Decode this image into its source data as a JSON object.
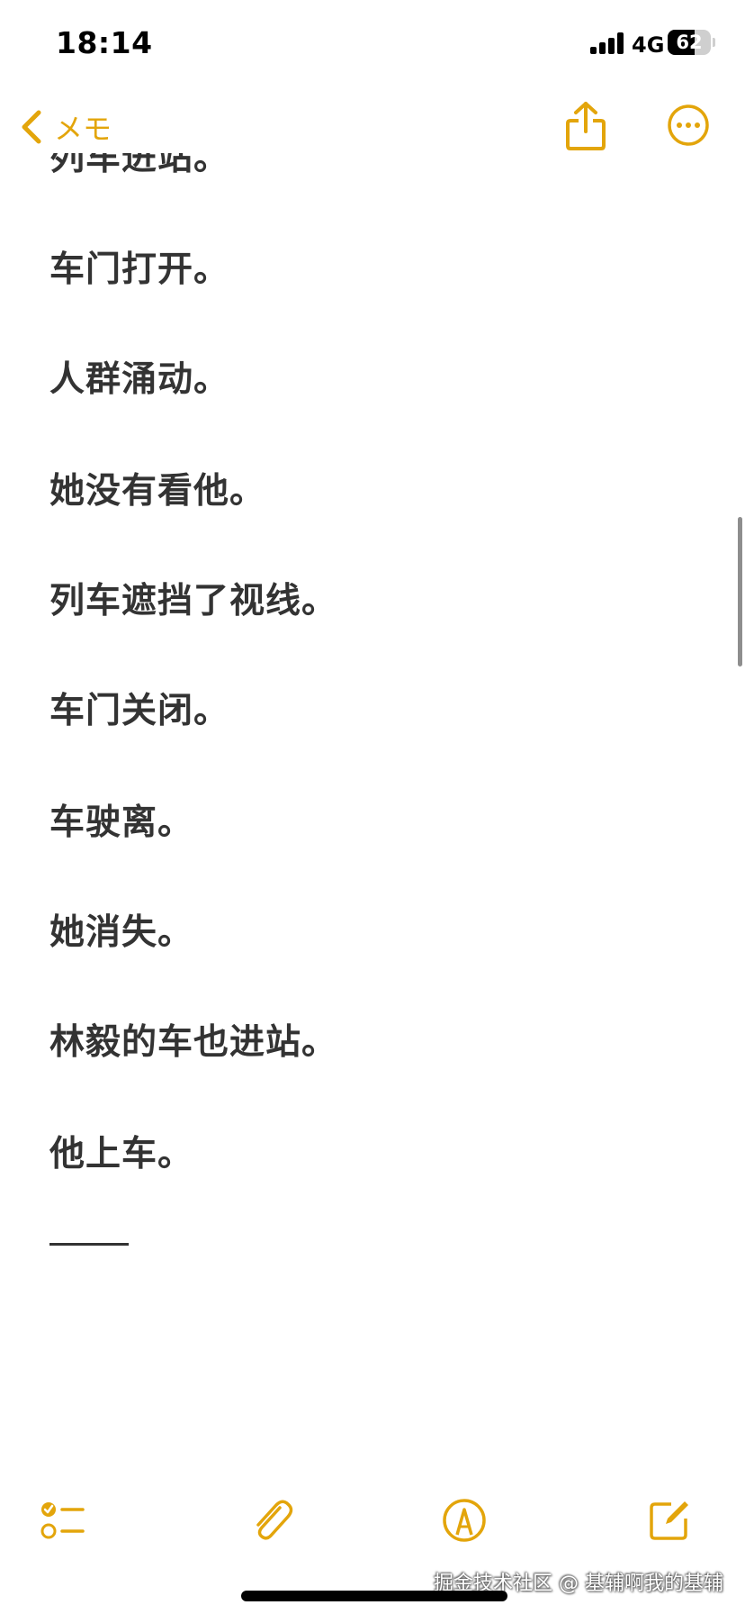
{
  "status_bar": {
    "time": "18:14",
    "network": "4G",
    "battery_level": "62",
    "battery_fraction": 0.62
  },
  "nav": {
    "back_label": "メモ",
    "back_icon": "chevron-left-icon",
    "share_icon": "share-icon",
    "more_icon": "ellipsis-circle-icon",
    "accent_color": "#e3a50b"
  },
  "note": {
    "lines": [
      "列车进站。",
      "车门打开。",
      "人群涌动。",
      "她没有看他。",
      "列车遮挡了视线。",
      "车门关闭。",
      "车驶离。",
      "她消失。",
      "林毅的车也进站。",
      "他上车。"
    ],
    "text_color": "#333333"
  },
  "toolbar": {
    "checklist_icon": "checklist-icon",
    "attachment_icon": "paperclip-icon",
    "markup_icon": "markup-pen-icon",
    "compose_icon": "compose-icon"
  },
  "watermark": "掘金技术社区 @ 基辅啊我的基辅"
}
